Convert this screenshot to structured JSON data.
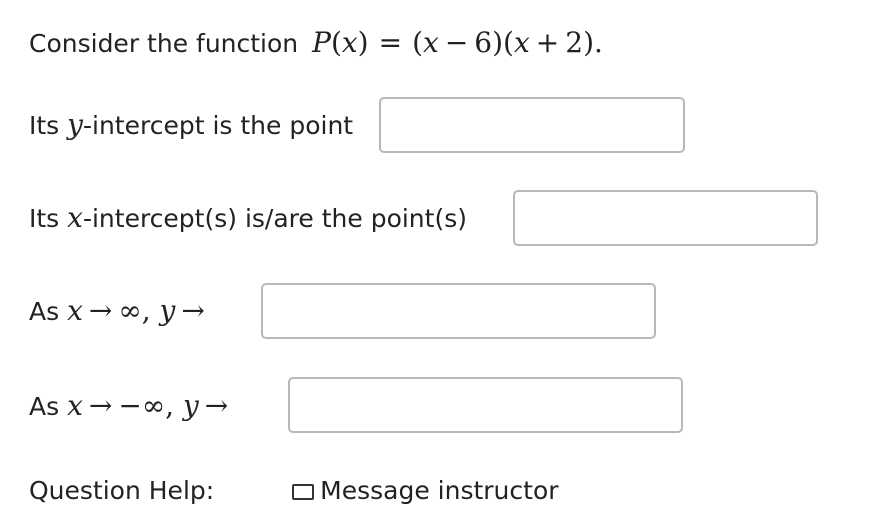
{
  "question": {
    "intro": "Consider the function",
    "func_name": "P",
    "var": "x",
    "factor1_const": "6",
    "factor2_const": "2",
    "period": "."
  },
  "rows": {
    "y_intercept": {
      "prefix": "Its",
      "var": "y",
      "suffix": "-intercept is the point",
      "value": ""
    },
    "x_intercepts": {
      "prefix": "Its",
      "var": "x",
      "suffix": "-intercept(s) is/are the point(s)",
      "value": ""
    },
    "pos_inf": {
      "prefix": "As",
      "x": "x",
      "arrow": "→",
      "inf": "∞",
      "comma": ",",
      "y": "y",
      "arrow2": "→",
      "value": ""
    },
    "neg_inf": {
      "prefix": "As",
      "x": "x",
      "arrow": "→",
      "inf": "−∞",
      "comma": ",",
      "y": "y",
      "arrow2": "→",
      "value": ""
    }
  },
  "footer": {
    "text": "Question Help:",
    "link": "Message instructor"
  }
}
